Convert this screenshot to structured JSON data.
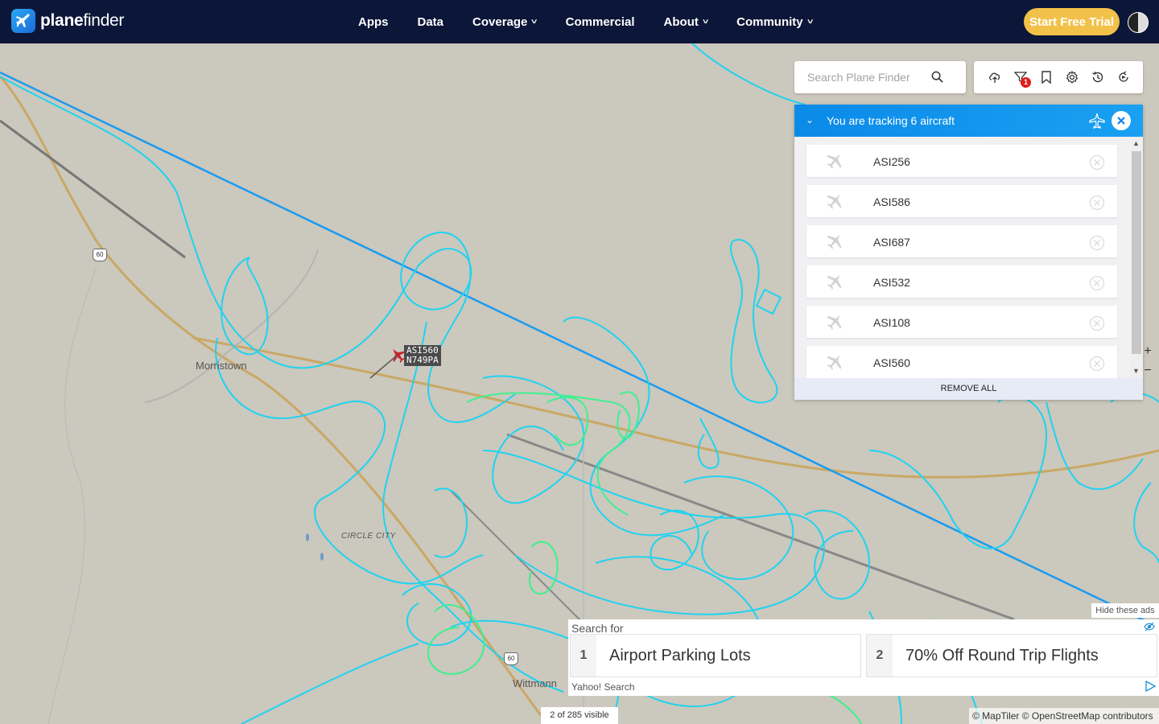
{
  "header": {
    "logo_text_bold": "plane",
    "logo_text_rest": "finder",
    "nav": [
      {
        "label": "Apps",
        "dropdown": false
      },
      {
        "label": "Data",
        "dropdown": false
      },
      {
        "label": "Coverage",
        "dropdown": true
      },
      {
        "label": "Commercial",
        "dropdown": false
      },
      {
        "label": "About",
        "dropdown": true
      },
      {
        "label": "Community",
        "dropdown": true
      }
    ],
    "trial_button": "Start Free Trial"
  },
  "search": {
    "placeholder": "Search Plane Finder"
  },
  "toolbar": {
    "icons": [
      "cloud-upload-icon",
      "filter-icon",
      "bookmark-icon",
      "settings-gear-icon",
      "history-clock-icon",
      "playback-icon"
    ],
    "filter_badge": "1"
  },
  "tracking": {
    "title": "You are tracking 6 aircraft",
    "aircraft": [
      "ASI256",
      "ASI586",
      "ASI687",
      "ASI532",
      "ASI108",
      "ASI560"
    ],
    "remove_all": "REMOVE ALL"
  },
  "map": {
    "selected_aircraft": {
      "callsign": "ASI560",
      "registration": "N749PA"
    },
    "places": [
      "Morristown",
      "CIRCLE CITY",
      "Wittmann"
    ],
    "highway_shields": [
      "60",
      "60"
    ],
    "track_colors": {
      "primary": "#1fd3f0",
      "route": "#1a9bf0",
      "alt": "#3ef08f"
    },
    "zoom_in": "+",
    "zoom_out": "−",
    "visible_count": "2 of 285 visible",
    "attribution": "© MapTiler © OpenStreetMap contributors"
  },
  "ads": {
    "hide_label": "Hide these ads",
    "search_for": "Search for",
    "items": [
      {
        "num": "1",
        "text": "Airport Parking Lots"
      },
      {
        "num": "2",
        "text": "70% Off Round Trip Flights"
      }
    ],
    "footer": "Yahoo! Search"
  }
}
